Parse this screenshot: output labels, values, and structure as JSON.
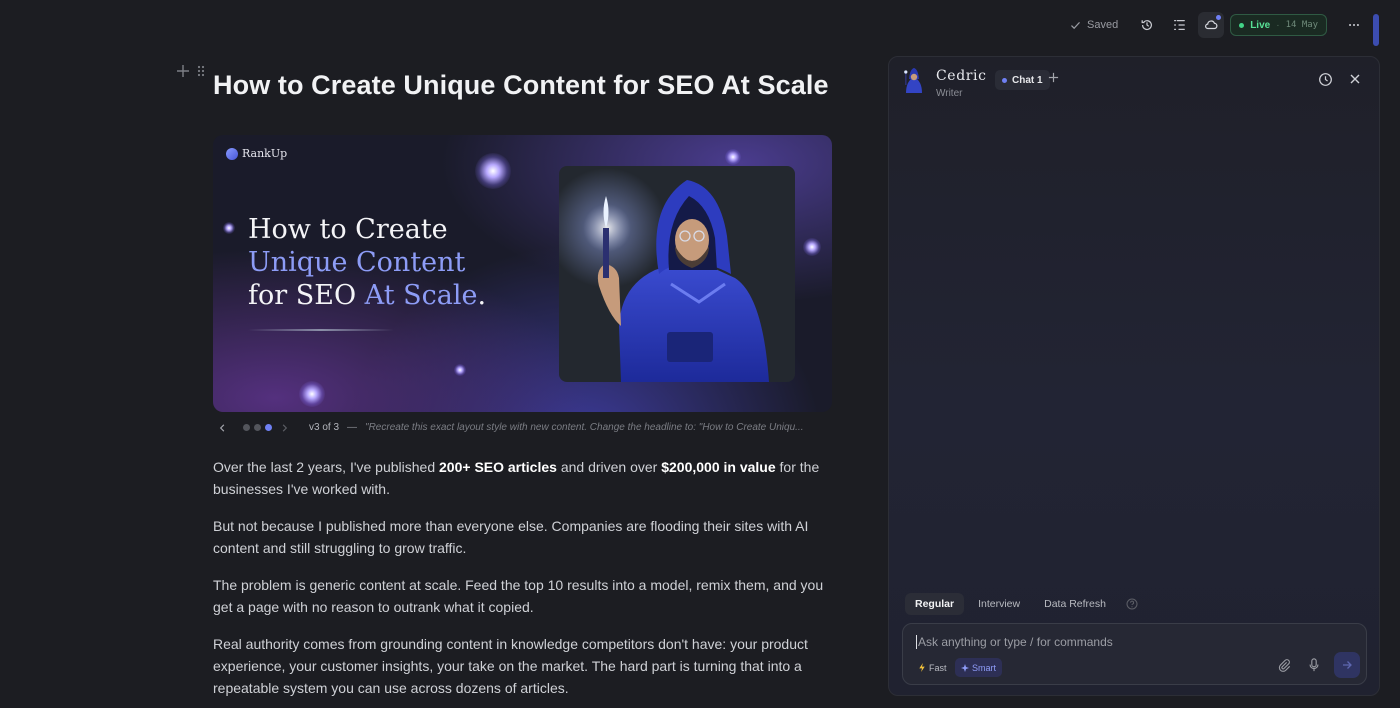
{
  "toolbar": {
    "saved_label": "Saved",
    "live_label": "Live",
    "live_separator": "·",
    "live_date": "14 May",
    "icons": [
      "check-icon",
      "history-icon",
      "outline-icon",
      "sync-icon",
      "more-icon"
    ],
    "accent_color": "#6f80f3",
    "live_color": "#42d487"
  },
  "document": {
    "title": "How to Create Unique Content for SEO At Scale",
    "hero": {
      "logo_text": "RankUp",
      "line1": "How to Create",
      "line2": "Unique Content",
      "line3_a": "for SEO ",
      "line3_b": "At Scale",
      "line3_c": "."
    },
    "carousel": {
      "version": "v3 of 3",
      "separator": "—",
      "prompt": "\"Recreate this exact layout style with new content. Change the headline to: \"How to Create Uniqu...",
      "active_index": 3,
      "total": 3
    },
    "paragraphs": {
      "p1_a": "Over the last 2 years, I've published ",
      "p1_b": "200+ SEO articles",
      "p1_c": " and driven over ",
      "p1_d": "$200,000 in value",
      "p1_e": " for the businesses I've worked with.",
      "p2": "But not because I published more than everyone else. Companies are flooding their sites with AI content and still struggling to grow traffic.",
      "p3": "The problem is generic content at scale. Feed the top 10 results into a model, remix them, and you get a page with no reason to outrank what it copied.",
      "p4": "Real authority comes from grounding content in knowledge competitors don't have: your product experience, your customer insights, your take on the market. The hard part is turning that into a repeatable system you can use across dozens of articles."
    }
  },
  "chat": {
    "agent_name": "Cedric",
    "agent_role": "Writer",
    "tab_label": "Chat 1",
    "modes": [
      "Regular",
      "Interview",
      "Data Refresh"
    ],
    "active_mode": "Regular",
    "input_placeholder": "Ask anything or type / for commands",
    "chip_fast": "Fast",
    "chip_smart": "Smart"
  }
}
